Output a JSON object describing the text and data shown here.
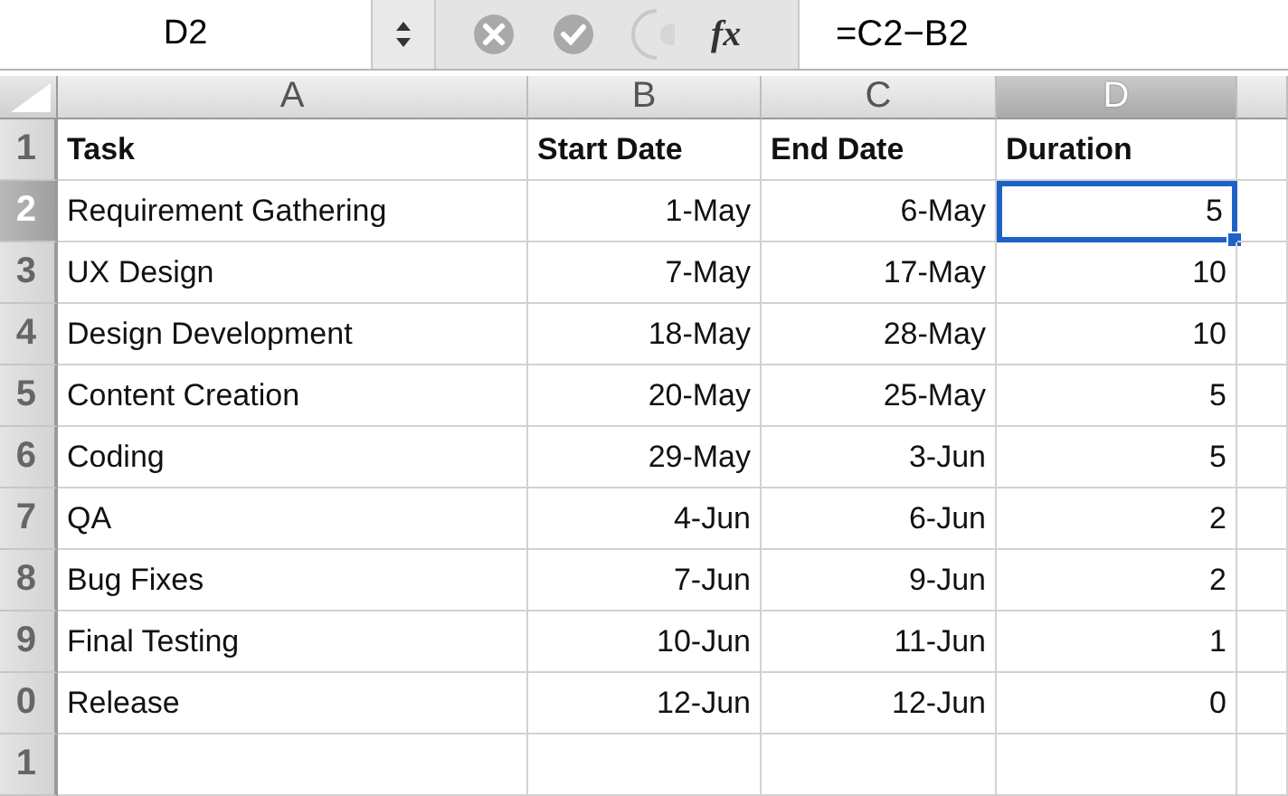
{
  "formula_bar": {
    "name_box": "D2",
    "function_label": "fx",
    "formula": "=C2−B2"
  },
  "table": {
    "columns": [
      {
        "label": "A",
        "selected": false
      },
      {
        "label": "B",
        "selected": false
      },
      {
        "label": "C",
        "selected": false
      },
      {
        "label": "D",
        "selected": true
      }
    ],
    "rows": [
      {
        "number": "1",
        "selected": false,
        "kind": "header",
        "cells": [
          "Task",
          "Start Date",
          "End Date",
          "Duration"
        ]
      },
      {
        "number": "2",
        "selected": true,
        "kind": "task",
        "cells": [
          "Requirement Gathering",
          "1-May",
          "6-May",
          "5"
        ]
      },
      {
        "number": "3",
        "selected": false,
        "kind": "task",
        "cells": [
          "UX Design",
          "7-May",
          "17-May",
          "10"
        ]
      },
      {
        "number": "4",
        "selected": false,
        "kind": "task",
        "cells": [
          "Design Development",
          "18-May",
          "28-May",
          "10"
        ]
      },
      {
        "number": "5",
        "selected": false,
        "kind": "task",
        "cells": [
          "Content Creation",
          "20-May",
          "25-May",
          "5"
        ]
      },
      {
        "number": "6",
        "selected": false,
        "kind": "task",
        "cells": [
          "Coding",
          "29-May",
          "3-Jun",
          "5"
        ]
      },
      {
        "number": "7",
        "selected": false,
        "kind": "task",
        "cells": [
          "QA",
          "4-Jun",
          "6-Jun",
          "2"
        ]
      },
      {
        "number": "8",
        "selected": false,
        "kind": "task",
        "cells": [
          "Bug Fixes",
          "7-Jun",
          "9-Jun",
          "2"
        ]
      },
      {
        "number": "9",
        "selected": false,
        "kind": "task",
        "cells": [
          "Final Testing",
          "10-Jun",
          "11-Jun",
          "1"
        ]
      },
      {
        "number": "0",
        "selected": false,
        "kind": "task",
        "cells": [
          "Release",
          "12-Jun",
          "12-Jun",
          "0"
        ]
      },
      {
        "number": "1",
        "selected": false,
        "kind": "task"
      }
    ]
  }
}
